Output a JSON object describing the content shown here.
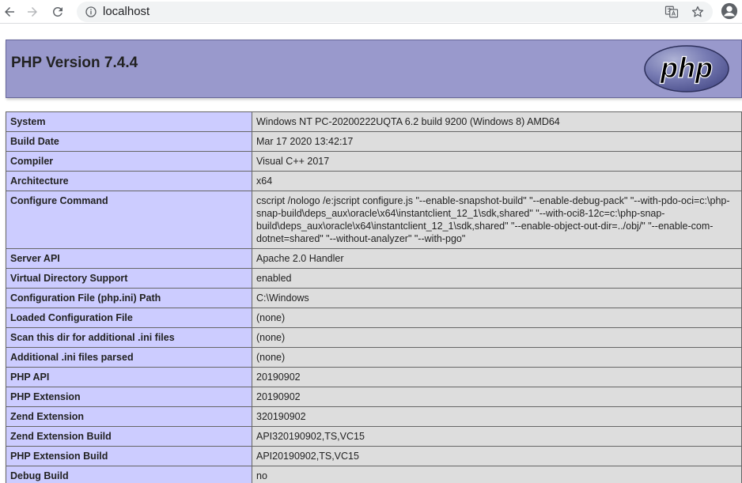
{
  "browser": {
    "url": "localhost"
  },
  "header": {
    "title": "PHP Version 7.4.4",
    "logo_text": "php"
  },
  "rows": [
    {
      "label": "System",
      "value": "Windows NT PC-20200222UQTA 6.2 build 9200 (Windows 8) AMD64"
    },
    {
      "label": "Build Date",
      "value": "Mar 17 2020 13:42:17"
    },
    {
      "label": "Compiler",
      "value": "Visual C++ 2017"
    },
    {
      "label": "Architecture",
      "value": "x64"
    },
    {
      "label": "Configure Command",
      "value": "cscript /nologo /e:jscript configure.js \"--enable-snapshot-build\" \"--enable-debug-pack\" \"--with-pdo-oci=c:\\php-snap-build\\deps_aux\\oracle\\x64\\instantclient_12_1\\sdk,shared\" \"--with-oci8-12c=c:\\php-snap-build\\deps_aux\\oracle\\x64\\instantclient_12_1\\sdk,shared\" \"--enable-object-out-dir=../obj/\" \"--enable-com-dotnet=shared\" \"--without-analyzer\" \"--with-pgo\""
    },
    {
      "label": "Server API",
      "value": "Apache 2.0 Handler"
    },
    {
      "label": "Virtual Directory Support",
      "value": "enabled"
    },
    {
      "label": "Configuration File (php.ini) Path",
      "value": "C:\\Windows"
    },
    {
      "label": "Loaded Configuration File",
      "value": "(none)"
    },
    {
      "label": "Scan this dir for additional .ini files",
      "value": "(none)"
    },
    {
      "label": "Additional .ini files parsed",
      "value": "(none)"
    },
    {
      "label": "PHP API",
      "value": "20190902"
    },
    {
      "label": "PHP Extension",
      "value": "20190902"
    },
    {
      "label": "Zend Extension",
      "value": "320190902"
    },
    {
      "label": "Zend Extension Build",
      "value": "API320190902,TS,VC15"
    },
    {
      "label": "PHP Extension Build",
      "value": "API20190902,TS,VC15"
    },
    {
      "label": "Debug Build",
      "value": "no"
    }
  ],
  "colors": {
    "header_bg": "#9999cc",
    "label_bg": "#ccccff",
    "value_bg": "#dddddd"
  }
}
